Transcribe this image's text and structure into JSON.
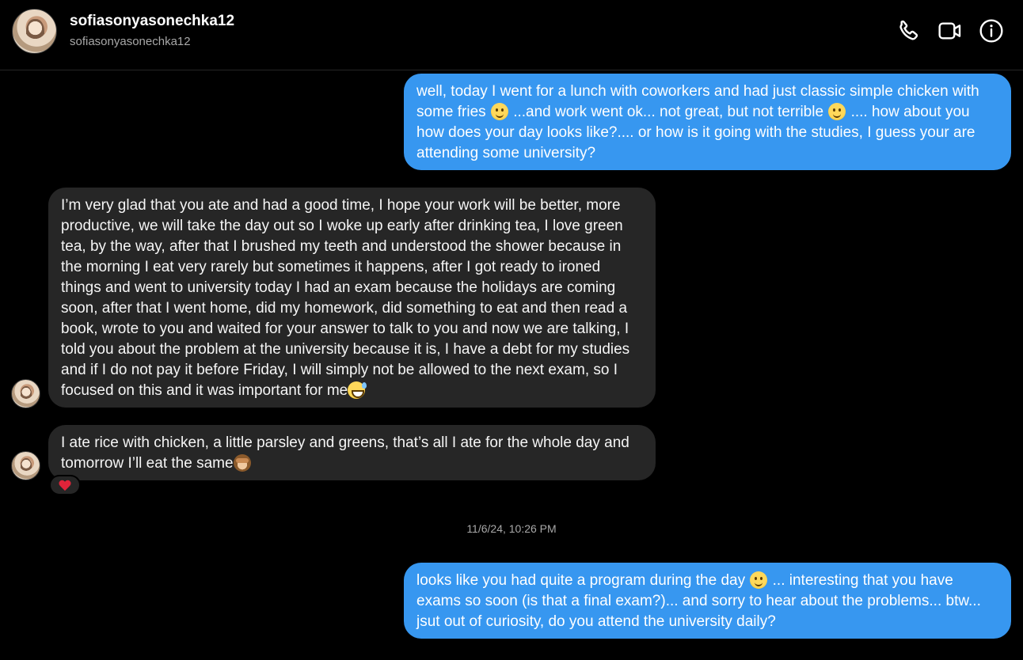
{
  "header": {
    "username": "sofiasonyasonechka12",
    "handle": "sofiasonyasonechka12",
    "icons": [
      "phone-icon",
      "video-icon",
      "info-icon"
    ]
  },
  "messages": [
    {
      "direction": "out",
      "parts": [
        "well, today I went for a lunch with coworkers and had just classic simple chicken with some fries ",
        " ...and work went ok... not great, but not terrible ",
        " .... how about you how does your day looks like?.... or how is it going with the studies, I guess your are attending some university?"
      ]
    },
    {
      "direction": "in",
      "parts": [
        "I’m very glad that you ate and had a good time, I hope your work will be better, more productive, we will take the day out so I woke up early after drinking tea, I love green tea, by the way, after that I brushed my teeth and understood the shower because in the morning I eat very rarely but sometimes it happens, after I got ready to ironed things and went to university today I had an exam because the holidays are coming soon, after that I went home, did my homework, did something to eat and then read a book, wrote to you and waited for your answer to talk to you and now we are talking, I told you about the problem at the university because it is, I have a debt for my studies and if I do not pay it before Friday, I will simply not be allowed to the next exam, so I focused on this and it was important for me"
      ]
    },
    {
      "direction": "in",
      "parts": [
        "I ate rice with chicken, a little parsley and greens, that’s all I ate for the whole day and tomorrow I’ll eat the same"
      ],
      "reaction": "❤️"
    },
    {
      "direction": "out",
      "parts": [
        "looks like you had quite a program during the day ",
        " ... interesting that you have exams so soon (is that a final exam?)... and  sorry to hear about the problems... btw... jsut out of curiosity, do you attend the university daily?"
      ]
    }
  ],
  "timestamp": "11/6/24, 10:26 PM",
  "colors": {
    "background": "#000000",
    "outgoing_bubble": "#3797f0",
    "incoming_bubble": "#262626",
    "secondary_text": "#a8a8a8"
  }
}
